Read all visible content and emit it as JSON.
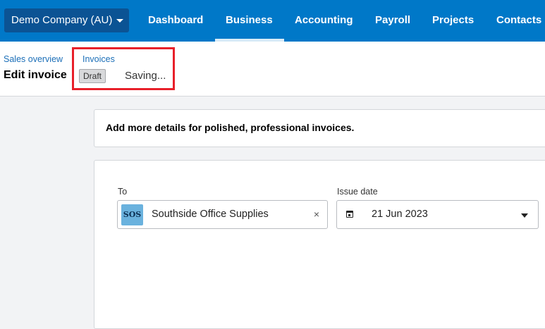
{
  "org_switcher": {
    "label": "Demo Company (AU)"
  },
  "nav": {
    "items": [
      {
        "label": "Dashboard"
      },
      {
        "label": "Business"
      },
      {
        "label": "Accounting"
      },
      {
        "label": "Payroll"
      },
      {
        "label": "Projects"
      },
      {
        "label": "Contacts"
      }
    ],
    "active": "Business"
  },
  "breadcrumb": {
    "parent": "Sales overview",
    "current": "Invoices"
  },
  "page": {
    "title": "Edit invoice",
    "status_badge": "Draft",
    "save_status": "Saving..."
  },
  "banner": {
    "text": "Add more details for polished, professional invoices."
  },
  "form": {
    "to": {
      "label": "To",
      "avatar_initials": "SOS",
      "value": "Southside Office Supplies",
      "clear_glyph": "×"
    },
    "issue_date": {
      "label": "Issue date",
      "value": "21 Jun 2023"
    }
  },
  "icons": [
    "chevron-down-icon",
    "calendar-icon",
    "close-icon"
  ],
  "colors": {
    "nav_bg": "#0078c8",
    "org_bg": "#0b5394",
    "highlight": "#e8202a",
    "avatar_bg": "#6ab2de"
  }
}
